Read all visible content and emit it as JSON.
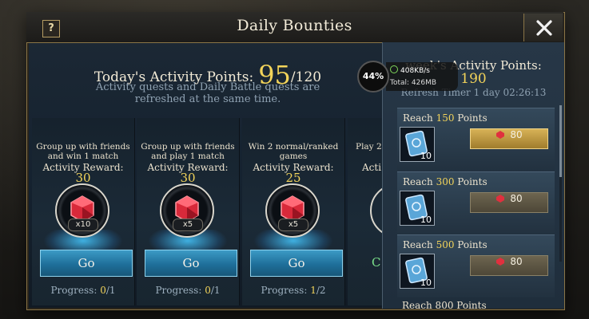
{
  "title": "Daily Bounties",
  "help_label": "?",
  "activity": {
    "label": "Today's Activity Points:",
    "current": "95",
    "max": "/120",
    "note": "Activity quests and Daily Battle quests are refreshed at the same time."
  },
  "quests": [
    {
      "desc": "Group up with friends and win 1 match",
      "reward_label": "Activity Reward:",
      "reward": "30",
      "qty": "x10",
      "go": "Go",
      "progress_label": "Progress: ",
      "progress_done": "0",
      "progress_total": "/1"
    },
    {
      "desc": "Group up with friends and play 1 match",
      "reward_label": "Activity Reward:",
      "reward": "30",
      "qty": "x5",
      "go": "Go",
      "progress_label": "Progress: ",
      "progress_done": "0",
      "progress_total": "/1"
    },
    {
      "desc": "Win 2 normal/ranked games",
      "reward_label": "Activity Reward:",
      "reward": "25",
      "qty": "x5",
      "go": "Go",
      "progress_label": "Progress: ",
      "progress_done": "1",
      "progress_total": "/2"
    },
    {
      "desc": "Play 2",
      "reward_label": "Acti",
      "reward": "",
      "qty": "",
      "go": "C",
      "progress_label": "",
      "progress_done": "",
      "progress_total": ""
    }
  ],
  "weekly": {
    "label": "week's Activity Points:",
    "value": "190",
    "timer": "Refresh Timer 1 day 02:26:13",
    "milestones": [
      {
        "reach": "Reach ",
        "points": "150",
        "suffix": " Points",
        "item_count": "10",
        "claim": "80",
        "state": "gold"
      },
      {
        "reach": "Reach ",
        "points": "300",
        "suffix": " Points",
        "item_count": "10",
        "claim": "80",
        "state": "dim"
      },
      {
        "reach": "Reach ",
        "points": "500",
        "suffix": " Points",
        "item_count": "10",
        "claim": "80",
        "state": "dim"
      }
    ],
    "next_peek": "Reach 800 Points"
  },
  "overlay": {
    "percent": "44%",
    "speed": "408KB/s",
    "total": "Total: 426MB"
  },
  "colors": {
    "accent_gold": "#f3d45a",
    "go_button": "#2a86b4",
    "gem_red": "#e0303e"
  }
}
